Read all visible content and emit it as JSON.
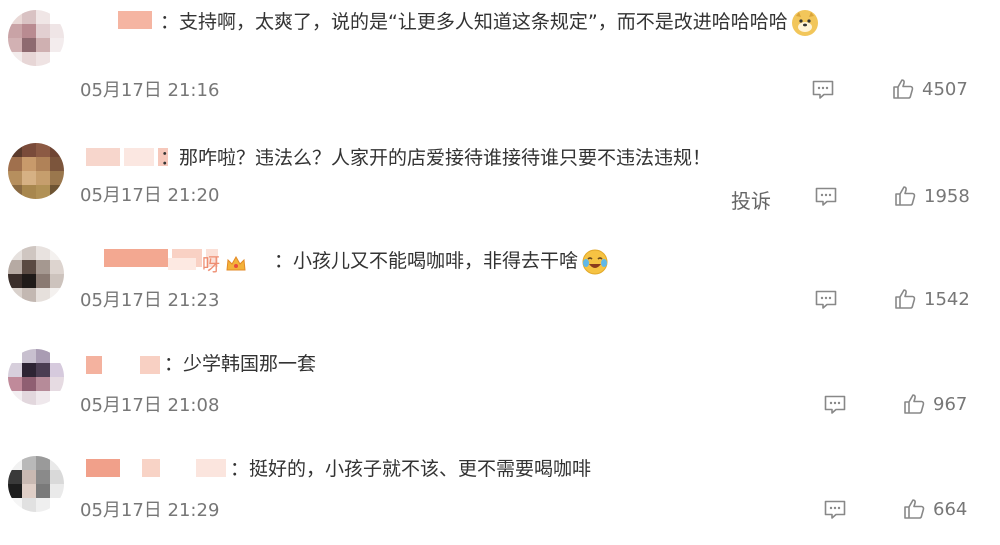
{
  "comments": [
    {
      "text": "：支持啊，太爽了，说的是“让更多人知道这条规定”，而不是改进哈哈哈哈",
      "emoji": "doge-emoji",
      "time": "05月17日 21:16",
      "likes": "4507"
    },
    {
      "text": "：那咋啦？违法么？人家开的店爱接待谁接待谁只要不违法违规！",
      "time": "05月17日 21:20",
      "likes": "1958",
      "report_label": "投诉"
    },
    {
      "name_suffix": "呀",
      "text": "：小孩儿又不能喝咖啡，非得去干啥",
      "emoji": "laughing-crying-emoji",
      "time": "05月17日 21:23",
      "likes": "1542"
    },
    {
      "text": "：少学韩国那一套",
      "time": "05月17日 21:08",
      "likes": "967"
    },
    {
      "text": "：挺好的，小孩子就不该、更不需要喝咖啡",
      "time": "05月17日 21:29",
      "likes": "664"
    }
  ],
  "colors": {
    "name_pixel": "#f2a48e",
    "meta_text": "#777777",
    "body_text": "#333333"
  },
  "icons": {
    "reply": "comment-bubble-icon",
    "like": "thumbs-up-icon",
    "crown": "crown-badge-icon"
  }
}
